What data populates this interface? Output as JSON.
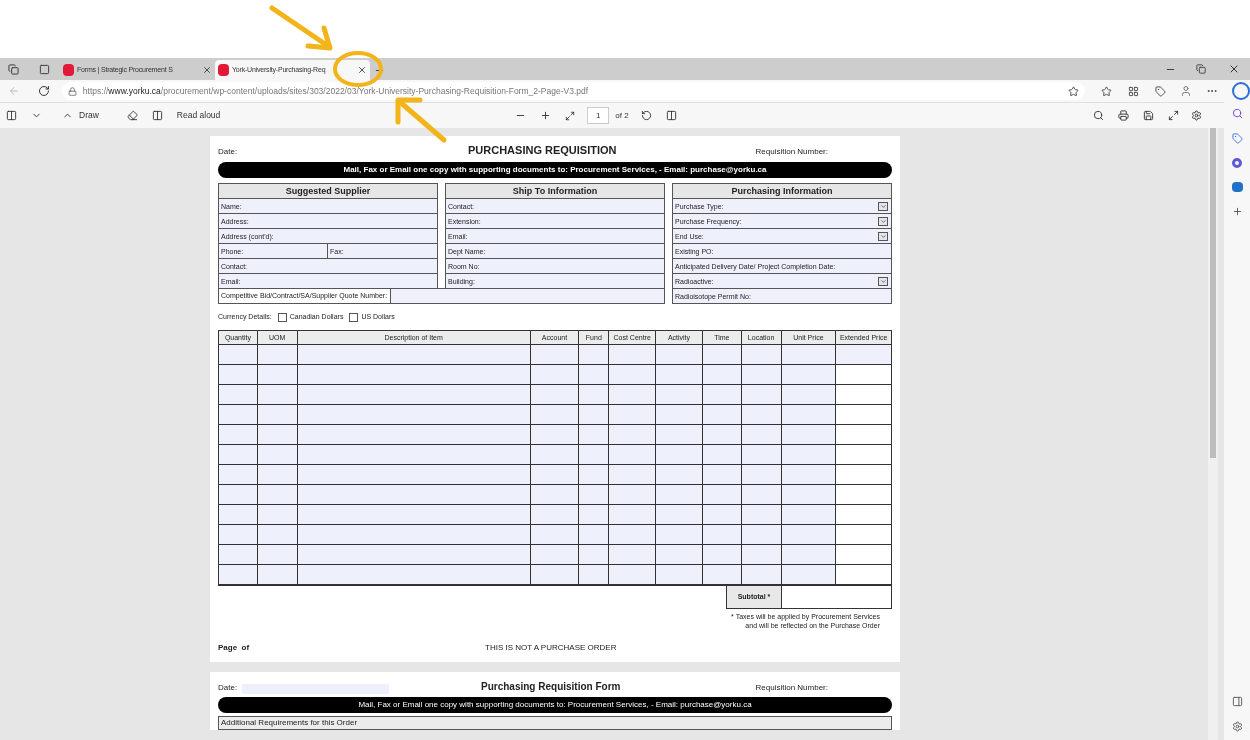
{
  "browser": {
    "tabs": [
      {
        "title": "Forms | Strategic Procurement S",
        "selected": false
      },
      {
        "title": "York-University-Purchasing-Req",
        "selected": true
      }
    ],
    "address": {
      "scheme": "https://",
      "host": "www.yorku.ca",
      "path": "/procurement/wp-content/uploads/sites/303/2022/03/York-University-Purchasing-Requisition-Form_2-Page-V3.pdf"
    }
  },
  "pdf_toolbar": {
    "draw": "Draw",
    "read_aloud": "Read aloud",
    "page": "1",
    "page_count": "of 2"
  },
  "page_1": {
    "date_label": "Date:",
    "title": "PURCHASING REQUISITION",
    "requisition_label": "Requisition Number:",
    "banner": "Mail, Fax or Email one copy with supporting documents to: Procurement Services, - Email: purchase@yorku.ca",
    "supplier": {
      "heading": "Suggested Supplier",
      "rows": [
        [
          "Name:"
        ],
        [
          "Address:"
        ],
        [
          "Address (cont'd):"
        ],
        [
          "Phone:",
          "Fax:"
        ],
        [
          "Contact:"
        ],
        [
          "Email:"
        ]
      ]
    },
    "ship_to": {
      "heading": "Ship To Information",
      "rows": [
        "Contact:",
        "Extension:",
        "Email:",
        "Dept Name:",
        "Room No:",
        "Building:"
      ]
    },
    "bid_label": "Competitive Bid/Contract/SA/Supplier Quote Number:",
    "purchasing": {
      "heading": "Purchasing Information",
      "rows": [
        {
          "label": "Purchase Type:",
          "dropdown": true
        },
        {
          "label": "Purchase Frequency:",
          "dropdown": true
        },
        {
          "label": "End Use:",
          "dropdown": true
        },
        {
          "label": "Existing PO:",
          "dropdown": false
        },
        {
          "label": "Anticipated Delivery Date/ Project Completion Date:",
          "dropdown": false
        },
        {
          "label": "Radioactive:",
          "dropdown": true
        },
        {
          "label": "Radioisotope Permit No:",
          "dropdown": false
        }
      ]
    },
    "currency": {
      "label": "Currency Details:",
      "options": [
        {
          "label": "Canadian Dollars",
          "checked": false
        },
        {
          "label": "US Dollars",
          "checked": false
        }
      ]
    },
    "table": {
      "columns": [
        "Quantity",
        "UOM",
        "Description of Item",
        "Account",
        "Fund",
        "Cost Centre",
        "Activity",
        "Time",
        "Location",
        "Unit Price",
        "Extended Price"
      ]
    },
    "subtotal_label": "Subtotal *",
    "tax_note": [
      "* Taxes will be applied by Procurement Services",
      "and will be reflected on the Purchase Order"
    ],
    "page_label": "Page  of",
    "footer": "THIS IS NOT A PURCHASE ORDER"
  },
  "page_2": {
    "date_label": "Date:",
    "title": "Purchasing Requisition Form",
    "requisition_label": "Requisition Number:",
    "banner": "Mail, Fax or Email one copy with supporting documents to: Procurement Services, - Email: purchase@yorku.ca",
    "section": "Additional Requirements for this Order"
  }
}
